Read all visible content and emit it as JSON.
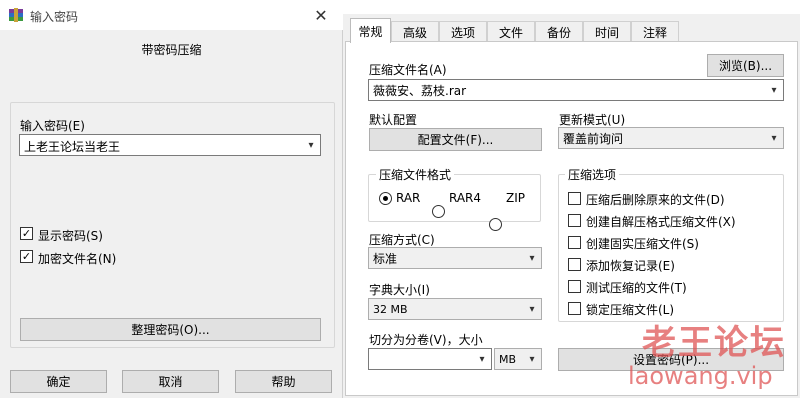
{
  "left_dialog": {
    "title": "输入密码",
    "heading": "带密码压缩",
    "password_label": "输入密码(E)",
    "password_value": "上老王论坛当老王",
    "show_password_label": "显示密码(S)",
    "show_password_checked": true,
    "encrypt_filenames_label": "加密文件名(N)",
    "encrypt_filenames_checked": true,
    "organize_button": "整理密码(O)...",
    "ok_button": "确定",
    "cancel_button": "取消",
    "help_button": "帮助"
  },
  "right_dialog": {
    "tabs": [
      {
        "label": "常规",
        "active": true
      },
      {
        "label": "高级",
        "active": false
      },
      {
        "label": "选项",
        "active": false
      },
      {
        "label": "文件",
        "active": false
      },
      {
        "label": "备份",
        "active": false
      },
      {
        "label": "时间",
        "active": false
      },
      {
        "label": "注释",
        "active": false
      }
    ],
    "archive_name_label": "压缩文件名(A)",
    "browse_button": "浏览(B)...",
    "archive_name_value": "薇薇安、荔枝.rar",
    "default_profile_label": "默认配置",
    "profile_button": "配置文件(F)...",
    "update_mode_label": "更新模式(U)",
    "update_mode_value": "覆盖前询问",
    "format_group_label": "压缩文件格式",
    "formats": [
      {
        "label": "RAR",
        "selected": true
      },
      {
        "label": "RAR4",
        "selected": false
      },
      {
        "label": "ZIP",
        "selected": false
      }
    ],
    "method_label": "压缩方式(C)",
    "method_value": "标准",
    "dict_label": "字典大小(I)",
    "dict_value": "32 MB",
    "split_label": "切分为分卷(V)，大小",
    "split_value": "",
    "split_unit": "MB",
    "options_group_label": "压缩选项",
    "options": [
      {
        "label": "压缩后删除原来的文件(D)",
        "checked": false
      },
      {
        "label": "创建自解压格式压缩文件(X)",
        "checked": false
      },
      {
        "label": "创建固实压缩文件(S)",
        "checked": false
      },
      {
        "label": "添加恢复记录(E)",
        "checked": false
      },
      {
        "label": "测试压缩的文件(T)",
        "checked": false
      },
      {
        "label": "锁定压缩文件(L)",
        "checked": false
      }
    ],
    "set_password_button": "设置密码(P)..."
  },
  "watermark": {
    "line1": "老王论坛",
    "line2": "laowang.vip"
  },
  "colors": {
    "accent_watermark": "#e05656",
    "dialog_bg": "#f0f0f0",
    "button_bg": "#e1e1e1"
  },
  "icons": {
    "app": "winrar-icon",
    "close": "close-icon",
    "dropdown": "chevron-down-icon"
  }
}
